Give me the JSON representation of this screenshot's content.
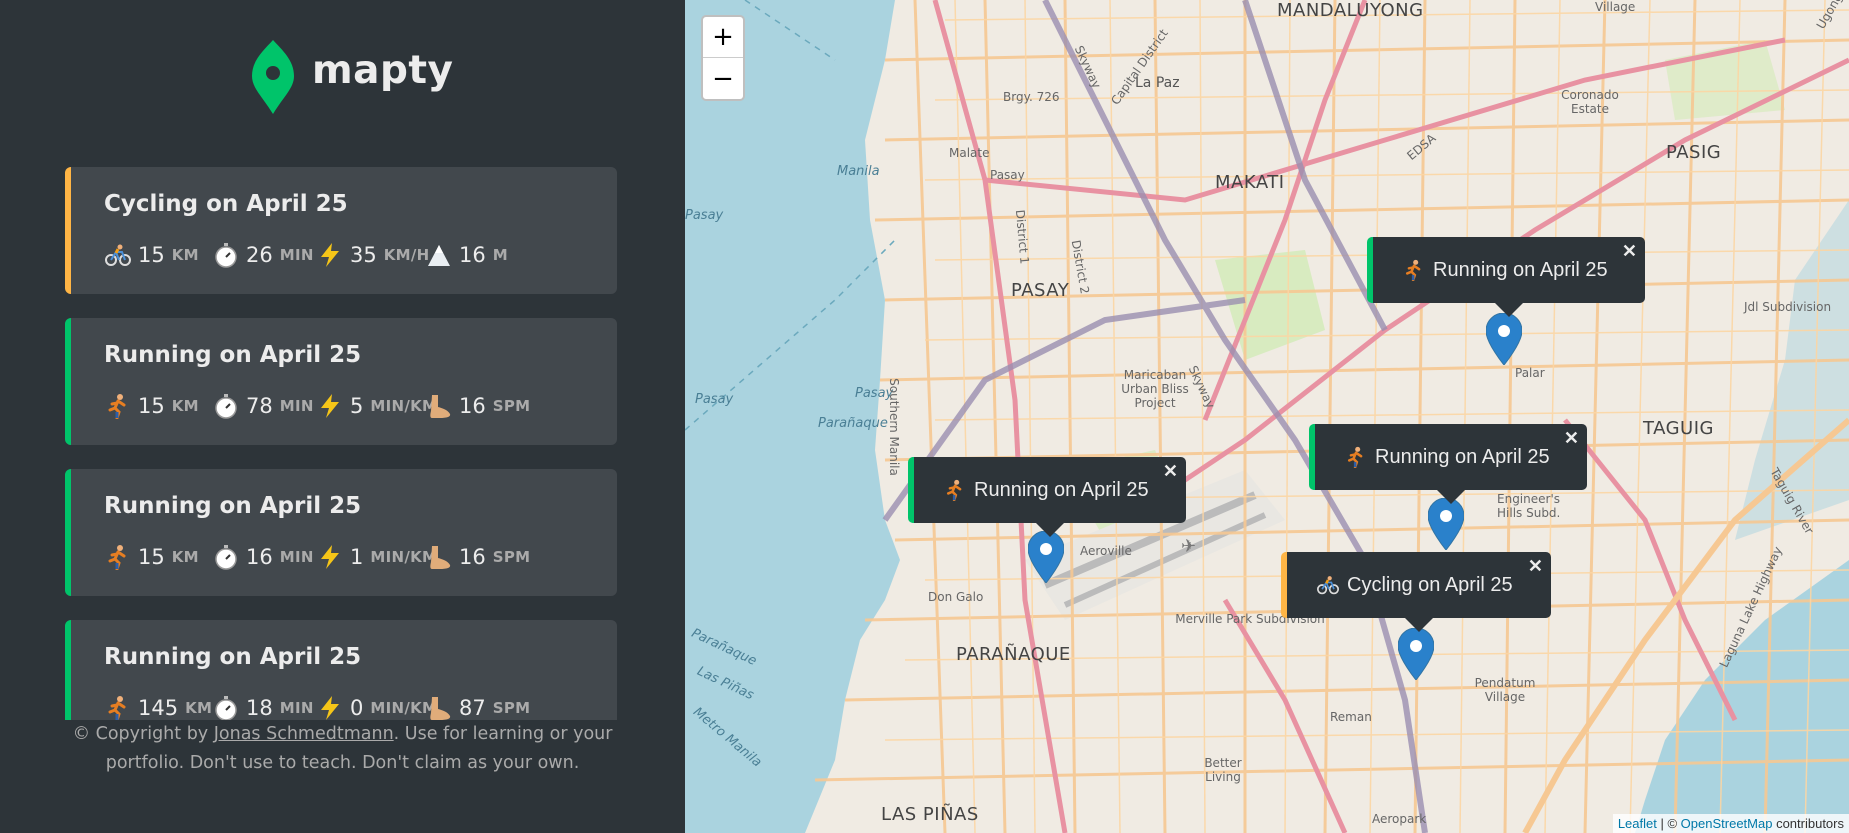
{
  "app": {
    "name": "mapty"
  },
  "colors": {
    "cycling": "#ffb545",
    "running": "#00c46a",
    "sidebar_bg": "#2d3439",
    "card_bg": "#42484d"
  },
  "workouts": [
    {
      "type": "cycling",
      "title": "Cycling on April 25",
      "details": [
        {
          "icon": "bicycle-icon",
          "value": "15",
          "unit": "KM"
        },
        {
          "icon": "stopwatch-icon",
          "value": "26",
          "unit": "MIN"
        },
        {
          "icon": "lightning-icon",
          "value": "35",
          "unit": "KM/H"
        },
        {
          "icon": "mountain-icon",
          "value": "16",
          "unit": "M"
        }
      ]
    },
    {
      "type": "running",
      "title": "Running on April 25",
      "details": [
        {
          "icon": "runner-icon",
          "value": "15",
          "unit": "KM"
        },
        {
          "icon": "stopwatch-icon",
          "value": "78",
          "unit": "MIN"
        },
        {
          "icon": "lightning-icon",
          "value": "5",
          "unit": "MIN/KM"
        },
        {
          "icon": "foot-icon",
          "value": "16",
          "unit": "SPM"
        }
      ]
    },
    {
      "type": "running",
      "title": "Running on April 25",
      "details": [
        {
          "icon": "runner-icon",
          "value": "15",
          "unit": "KM"
        },
        {
          "icon": "stopwatch-icon",
          "value": "16",
          "unit": "MIN"
        },
        {
          "icon": "lightning-icon",
          "value": "1",
          "unit": "MIN/KM"
        },
        {
          "icon": "foot-icon",
          "value": "16",
          "unit": "SPM"
        }
      ]
    },
    {
      "type": "running",
      "title": "Running on April 25",
      "details": [
        {
          "icon": "runner-icon",
          "value": "145",
          "unit": "KM"
        },
        {
          "icon": "stopwatch-icon",
          "value": "18",
          "unit": "MIN"
        },
        {
          "icon": "lightning-icon",
          "value": "0",
          "unit": "MIN/KM"
        },
        {
          "icon": "foot-icon",
          "value": "87",
          "unit": "SPM"
        }
      ]
    }
  ],
  "copyright": {
    "prefix": "© Copyright by ",
    "author": "Jonas Schmedtmann",
    "suffix_line1": ". Use for learning or your",
    "line2": "portfolio. Don't use to teach. Don't claim as your own."
  },
  "map": {
    "zoom_in": "+",
    "zoom_out": "−",
    "popups": [
      {
        "type": "running",
        "text": "Running on April 25",
        "close": "✕"
      },
      {
        "type": "running",
        "text": "Running on April 25",
        "close": "✕"
      },
      {
        "type": "running",
        "text": "Running on April 25",
        "close": "✕"
      },
      {
        "type": "cycling",
        "text": "Cycling on April 25",
        "close": "✕"
      }
    ],
    "labels": {
      "mandaluyong": "MANDALUYONG",
      "makati": "MAKATI",
      "pasay": "PASAY",
      "pasig": "PASIG",
      "taguig": "TAGUIG",
      "paranaque": "PARAÑAQUE",
      "las_pinas": "LAS PIÑAS",
      "manila_water": "Manila",
      "pasay_water1": "Pasay",
      "pasay_water2": "Pasay",
      "pasay_water3": "Pasay",
      "paranaque_water": "Parañaque",
      "parañaque_water2": "Parañaque",
      "las_pinas_water": "Las Piñas",
      "metro_manila": "Metro Manila",
      "la_paz": "La Paz",
      "brgy": "Brgy. 726",
      "malate": "Malate",
      "pasay_small": "Pasay",
      "skyway1": "Skyway",
      "skyway2": "Skyway",
      "capital": "Capital District",
      "district1": "District 1",
      "district2": "District 2",
      "edsa": "EDSA",
      "coronado": "Coronado Estate",
      "palar": "Palar",
      "maricaban": "Maricaban Urban Bliss Project",
      "aeroville": "Aeroville",
      "don_galo": "Don Galo",
      "merville": "Merville Park Subdivision",
      "engineers": "Engineer's Hills Subd.",
      "pendatum": "Pendatum Village",
      "reman": "Reman",
      "better_living": "Better Living",
      "aeropark": "Aeropark",
      "jdl": "Jdl Subdivision",
      "laguna": "Laguna Lake Highway",
      "taguig_river": "Taguig River",
      "southern_manila": "Southern Manila",
      "village": "Village",
      "ugong": "Ugong"
    },
    "attribution": {
      "leaflet": "Leaflet",
      "sep": " | © ",
      "osm": "OpenStreetMap",
      "suffix": " contributors"
    }
  }
}
